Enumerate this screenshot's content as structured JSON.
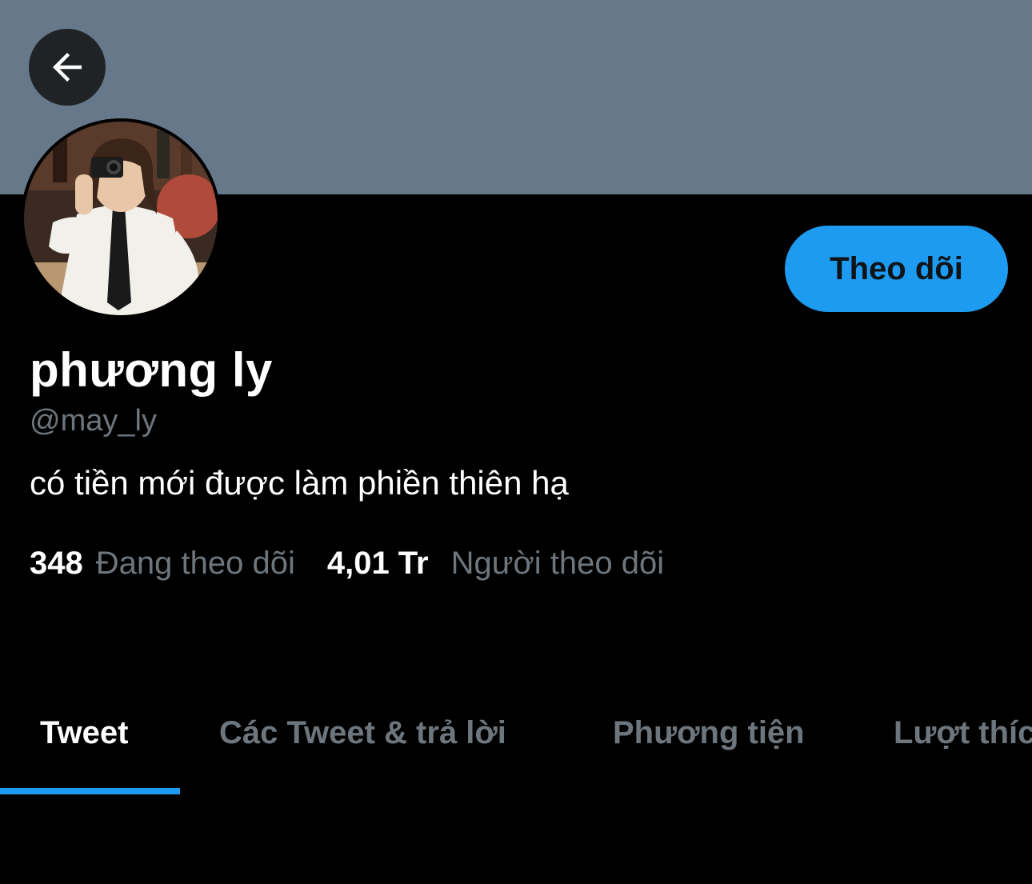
{
  "header": {
    "back_icon": "arrow-left-icon"
  },
  "profile": {
    "display_name": "phương ly",
    "handle": "@may_ly",
    "bio": "có tiền mới được làm phiền thiên hạ",
    "follow_label": "Theo dõi"
  },
  "stats": {
    "following_count": "348",
    "following_label": "Đang theo dõi",
    "followers_count": "4,01 Tr",
    "followers_label": "Người theo dõi"
  },
  "tabs": [
    {
      "label": "Tweet",
      "active": true
    },
    {
      "label": "Các Tweet & trả lời",
      "active": false
    },
    {
      "label": "Phương tiện",
      "active": false
    },
    {
      "label": "Lượt thích",
      "active": false
    }
  ],
  "colors": {
    "banner": "#66788a",
    "accent": "#1d9bf0",
    "muted_text": "#6e767d",
    "background": "#000000"
  }
}
